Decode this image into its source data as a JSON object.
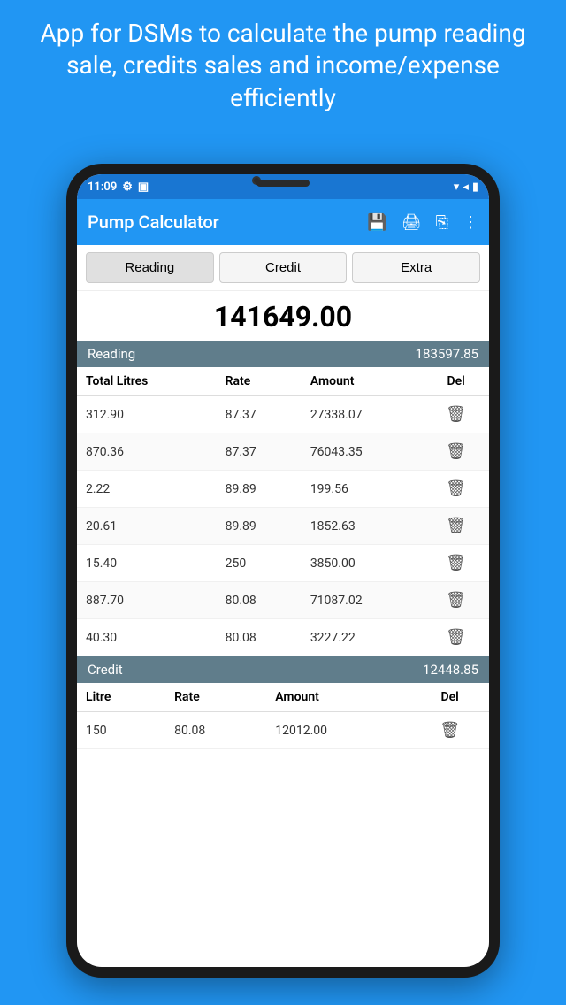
{
  "header": {
    "title": "App for DSMs to calculate the pump reading sale, credits sales and income/expense  efficiently"
  },
  "status_bar": {
    "time": "11:09",
    "settings_icon": "⚙",
    "sim_icon": "▣"
  },
  "app_bar": {
    "title": "Pump Calculator",
    "save_icon": "💾",
    "print_icon": "🖨",
    "share_icon": "⎘",
    "more_icon": "⋮"
  },
  "tabs": [
    {
      "label": "Reading",
      "active": true
    },
    {
      "label": "Credit",
      "active": false
    },
    {
      "label": "Extra",
      "active": false
    }
  ],
  "total": "141649.00",
  "reading_section": {
    "label": "Reading",
    "value": "183597.85"
  },
  "reading_table": {
    "columns": [
      "Total Litres",
      "Rate",
      "Amount",
      "Del"
    ],
    "rows": [
      {
        "litres": "312.90",
        "rate": "87.37",
        "amount": "27338.07"
      },
      {
        "litres": "870.36",
        "rate": "87.37",
        "amount": "76043.35"
      },
      {
        "litres": "2.22",
        "rate": "89.89",
        "amount": "199.56"
      },
      {
        "litres": "20.61",
        "rate": "89.89",
        "amount": "1852.63"
      },
      {
        "litres": "15.40",
        "rate": "250",
        "amount": "3850.00"
      },
      {
        "litres": "887.70",
        "rate": "80.08",
        "amount": "71087.02"
      },
      {
        "litres": "40.30",
        "rate": "80.08",
        "amount": "3227.22"
      }
    ]
  },
  "credit_section": {
    "label": "Credit",
    "value": "12448.85"
  },
  "credit_table": {
    "columns": [
      "Litre",
      "Rate",
      "Amount",
      "Del"
    ],
    "rows": [
      {
        "litre": "150",
        "rate": "80.08",
        "amount": "12012.00"
      }
    ]
  }
}
